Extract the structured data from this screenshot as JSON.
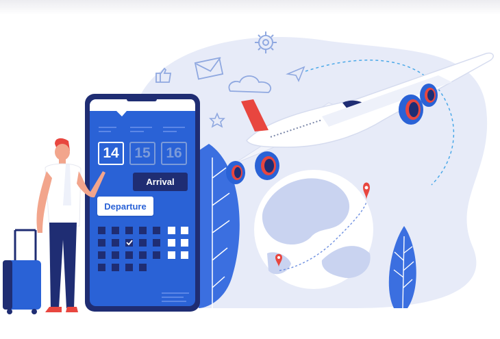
{
  "calendar": {
    "dates": [
      {
        "label": "14",
        "selected": true
      },
      {
        "label": "15",
        "selected": false
      },
      {
        "label": "16",
        "selected": false
      }
    ],
    "arrival_label": "Arrival",
    "departure_label": "Departure"
  },
  "colors": {
    "primary_blue": "#2a62d6",
    "dark_navy": "#1f2d73",
    "pale_blue": "#e7ebf8",
    "accent_red": "#e8463f"
  },
  "icons": [
    "gear-icon",
    "thumbs-up-icon",
    "envelope-icon",
    "paper-plane-icon",
    "cloud-icon",
    "star-icon",
    "map-pin-icon",
    "checkmark-icon"
  ]
}
